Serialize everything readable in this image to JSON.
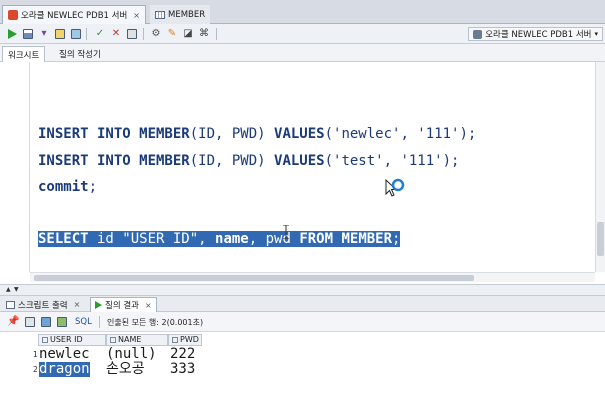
{
  "tabs": [
    {
      "label": "오라클 NEWLEC PDB1 서버",
      "active": true
    },
    {
      "label": "MEMBER",
      "active": false
    }
  ],
  "toolbar": {
    "connection_label": "오라클 NEWLEC PDB1 서버"
  },
  "subtabs": [
    "워크시트",
    "질의 작성기"
  ],
  "editor": {
    "lines": [
      {
        "kw1": "INSERT INTO MEMBER",
        "rest": "(ID, PWD) ",
        "kw2": "VALUES",
        "rest2": "('newlec', '111');"
      },
      {
        "kw1": "INSERT INTO MEMBER",
        "rest": "(ID, PWD) ",
        "kw2": "VALUES",
        "rest2": "('test', '111');"
      },
      {
        "kw1": "commit",
        "rest": ";",
        "kw2": "",
        "rest2": ""
      }
    ],
    "selected_line": {
      "kw1": "SELECT",
      "part2": " id ",
      "str1": "\"USER ID\"",
      "part3": ", ",
      "kw2": "name",
      "part4": ", pwd ",
      "kw3": "FROM MEMBER",
      "part5": ";"
    }
  },
  "bottom_tabs": [
    {
      "label": "스크립트 출력",
      "active": false
    },
    {
      "label": "질의 결과",
      "active": true
    }
  ],
  "results_toolbar": {
    "sql_label": "SQL",
    "status": "인출된 모든 행: 2(0.001초)"
  },
  "grid": {
    "columns": [
      "USER ID",
      "NAME",
      "PWD"
    ],
    "rows": [
      {
        "num": "1",
        "cells": [
          "newlec",
          "(null)",
          "222"
        ]
      },
      {
        "num": "2",
        "cells": [
          "dragon",
          "손오공",
          "333"
        ]
      }
    ]
  },
  "colors": {
    "selection": "#3169b3",
    "keyword": "#1b3a78",
    "run_green": "#2b9c2f",
    "db_icon": "#d94a2c"
  }
}
